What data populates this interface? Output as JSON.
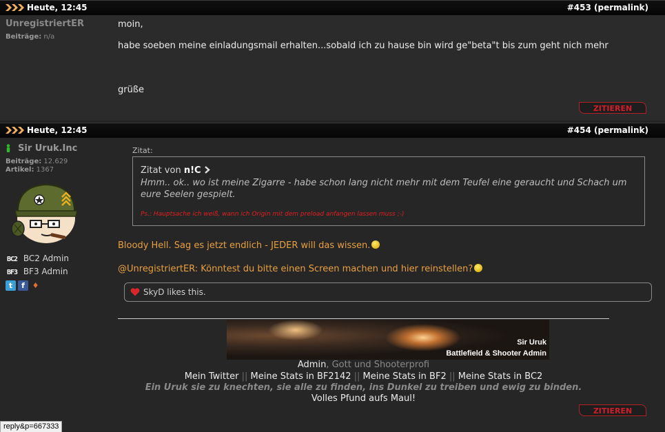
{
  "posts": [
    {
      "date": "Heute, 12:45",
      "number": "#453",
      "permalink": "(permalink)",
      "username": "UnregistriertER",
      "beitraege_label": "Beiträge:",
      "beitraege_value": "n/a",
      "lines": [
        "moin,",
        "habe soeben meine einladungsmail erhalten...sobald ich zu hause bin wird ge\"beta\"t bis zum geht nich mehr",
        "grüße"
      ],
      "quote_button": "ZITIEREN"
    },
    {
      "date": "Heute, 12:45",
      "number": "#454",
      "permalink": "(permalink)",
      "username": "Sir Uruk.Inc",
      "beitraege_label": "Beiträge:",
      "beitraege_value": "12.629",
      "artikel_label": "Artikel:",
      "artikel_value": "1367",
      "roles": [
        {
          "tag": "BC2",
          "label": "BC2 Admin"
        },
        {
          "tag": "BF3",
          "label": "BF3 Admin"
        }
      ],
      "quote": {
        "label": "Zitat:",
        "author_prefix": "Zitat von",
        "author": "n!C",
        "text": "Hmm.. ok.. wo ist meine Zigarre - habe schon lang nicht mehr mit dem Teufel eine geraucht und Schach um eure Seelen gespielt.",
        "ps": "Ps.: Hauptsache ich weiß, wann ich Origin mit dem preload anfangen lassen muss ;-)"
      },
      "reply_line1": "Bloody Hell. Sag es jetzt endlich - JEDER will das wissen.",
      "reply_line2": "@UnregistriertER: Könntest du bitte einen Screen machen und hier reinstellen?",
      "likes": "SkyD likes this.",
      "signature": {
        "banner_line1": "Sir Uruk",
        "banner_line2": "Battlefield & Shooter Admin",
        "role_admin": "Admin",
        "role_rest": ", Gott und Shooterprofi",
        "links": [
          "Mein Twitter",
          "Meine Stats in BF2142",
          "Meine Stats in BF2",
          "Meine Stats in BC2"
        ],
        "separator": "||",
        "quote": "Ein Uruk sie zu knechten, sie alle zu finden, ins Dunkel zu treiben und ewig zu binden.",
        "closing": "Volles Pfund aufs Maul!"
      },
      "quote_button": "ZITIEREN"
    }
  ],
  "status_bar": "reply&p=667333",
  "colors": {
    "background": "#232323",
    "header": "#050505",
    "accent_orange": "#e8a040",
    "zitieren_red": "#d01e2a",
    "ps_red": "#e02020"
  }
}
